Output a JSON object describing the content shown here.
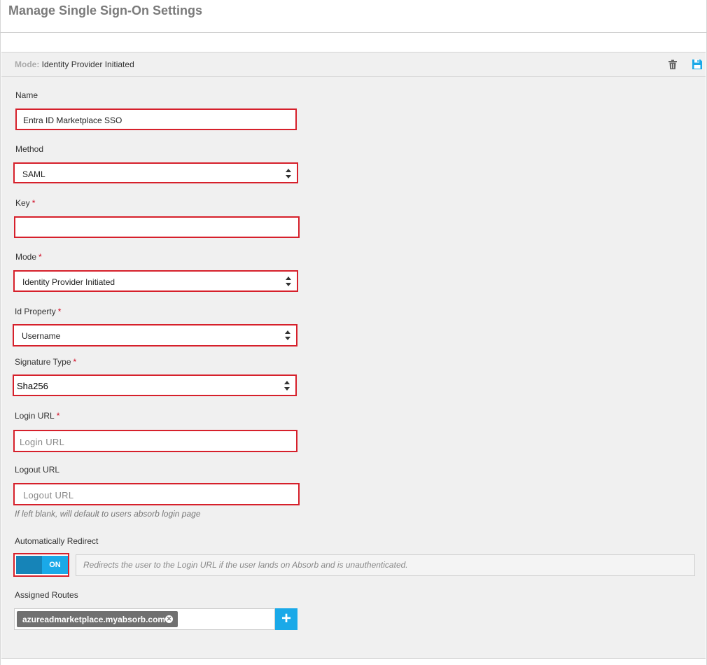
{
  "page": {
    "title": "Manage Single Sign-On Settings"
  },
  "header": {
    "mode_label": "Mode:",
    "mode_value": "Identity Provider Initiated",
    "delete_icon": "trash-icon",
    "save_icon": "save-icon"
  },
  "form": {
    "name": {
      "label": "Name",
      "value": "Entra ID Marketplace SSO"
    },
    "method": {
      "label": "Method",
      "value": "SAML"
    },
    "key": {
      "label": "Key",
      "required": "*",
      "value": ""
    },
    "mode": {
      "label": "Mode",
      "required": "*",
      "value": "Identity Provider Initiated"
    },
    "id_property": {
      "label": "Id Property",
      "required": "*",
      "value": "Username"
    },
    "signature_type": {
      "label": "Signature Type",
      "required": "*",
      "value": "Sha256"
    },
    "login_url": {
      "label": "Login URL",
      "required": "*",
      "placeholder": "Login URL"
    },
    "logout_url": {
      "label": "Logout URL",
      "placeholder": "Logout URL",
      "hint": "If left blank, will default to users absorb login page"
    },
    "auto_redirect": {
      "label": "Automatically Redirect",
      "state": "ON",
      "description": "Redirects the user to the Login URL if the user lands on Absorb and is unauthenticated."
    },
    "assigned_routes": {
      "label": "Assigned Routes",
      "routes": [
        "azureadmarketplace.myabsorb.com"
      ],
      "add_label": "+"
    }
  },
  "colors": {
    "accent": "#1aa9e8",
    "highlight": "#d6202b"
  }
}
